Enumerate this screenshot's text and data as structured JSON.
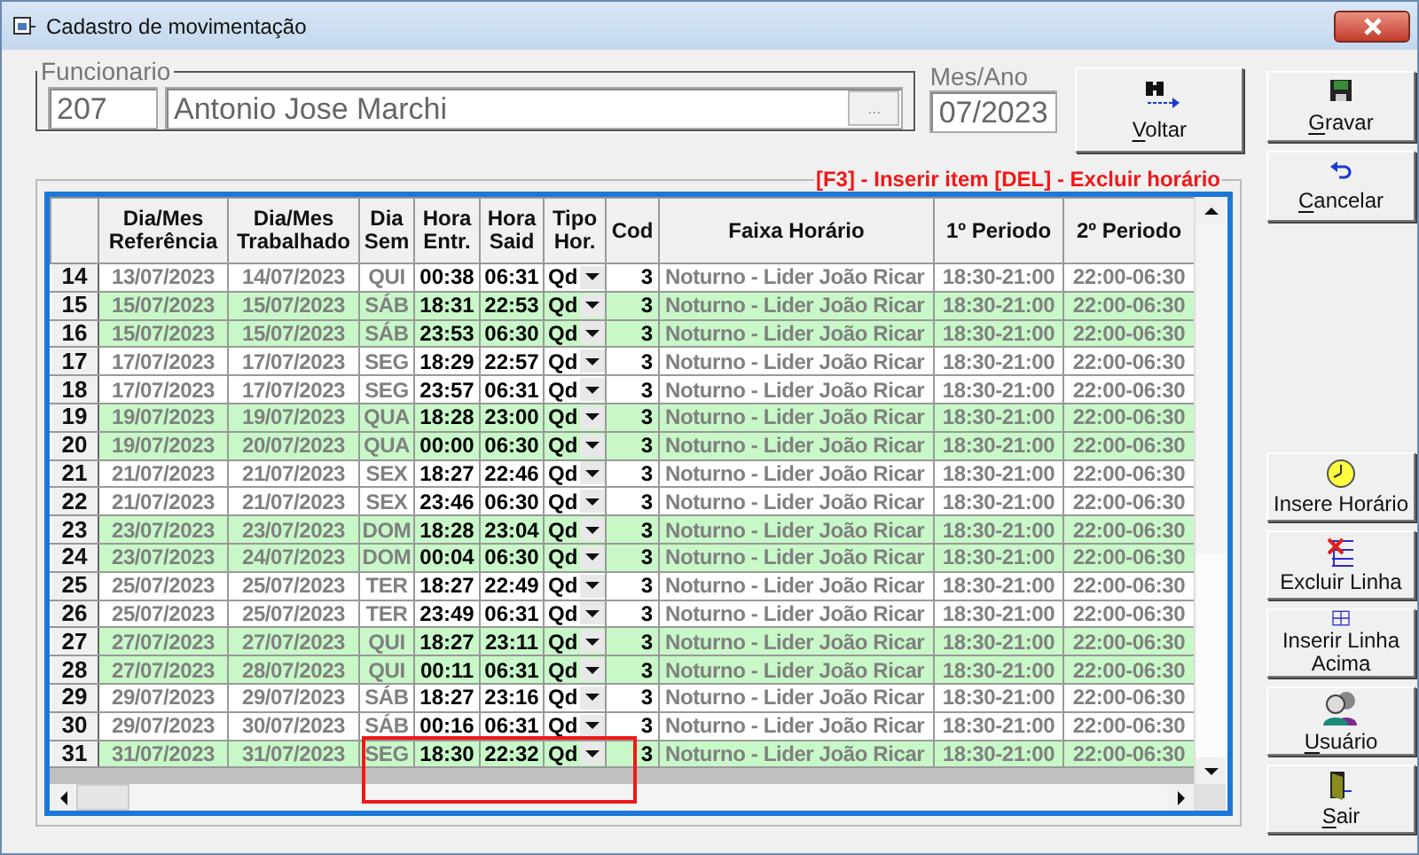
{
  "window": {
    "title": "Cadastro de movimentação"
  },
  "funcionario": {
    "label": "Funcionario",
    "code": "207",
    "name": "Antonio Jose Marchi",
    "lookup_button": "..."
  },
  "mes_ano": {
    "label": "Mes/Ano",
    "value": "07/2023"
  },
  "top_buttons": [
    {
      "kind": "voltar",
      "label": "Voltar"
    },
    {
      "kind": "gravar",
      "label": "Gravar"
    },
    {
      "kind": "cancelar",
      "label": "Cancelar"
    }
  ],
  "grid_hint": "[F3] - Inserir item [DEL] - Excluir horário",
  "columns": [
    "",
    "Dia/Mes Referência",
    "Dia/Mes Trabalhado",
    "Dia Sem",
    "Hora Entr.",
    "Hora Said",
    "Tipo Hor.",
    "Cod",
    "Faixa Horário",
    "1º Periodo",
    "2º Periodo"
  ],
  "rows": [
    {
      "num": "14",
      "ref": "13/07/2023",
      "trab": "14/07/2023",
      "dia": "QUI",
      "entrada": "00:38",
      "saida": "06:31",
      "tipo": "Qd",
      "cod": "3",
      "faixa": "Noturno - Lider João Ricar",
      "p1": "18:30-21:00",
      "p2": "22:00-06:30",
      "highlighted": false
    },
    {
      "num": "15",
      "ref": "15/07/2023",
      "trab": "15/07/2023",
      "dia": "SÁB",
      "entrada": "18:31",
      "saida": "22:53",
      "tipo": "Qd",
      "cod": "3",
      "faixa": "Noturno - Lider João Ricar",
      "p1": "18:30-21:00",
      "p2": "22:00-06:30",
      "highlighted": true
    },
    {
      "num": "16",
      "ref": "15/07/2023",
      "trab": "15/07/2023",
      "dia": "SÁB",
      "entrada": "23:53",
      "saida": "06:30",
      "tipo": "Qd",
      "cod": "3",
      "faixa": "Noturno - Lider João Ricar",
      "p1": "18:30-21:00",
      "p2": "22:00-06:30",
      "highlighted": true
    },
    {
      "num": "17",
      "ref": "17/07/2023",
      "trab": "17/07/2023",
      "dia": "SEG",
      "entrada": "18:29",
      "saida": "22:57",
      "tipo": "Qd",
      "cod": "3",
      "faixa": "Noturno - Lider João Ricar",
      "p1": "18:30-21:00",
      "p2": "22:00-06:30",
      "highlighted": false
    },
    {
      "num": "18",
      "ref": "17/07/2023",
      "trab": "17/07/2023",
      "dia": "SEG",
      "entrada": "23:57",
      "saida": "06:31",
      "tipo": "Qd",
      "cod": "3",
      "faixa": "Noturno - Lider João Ricar",
      "p1": "18:30-21:00",
      "p2": "22:00-06:30",
      "highlighted": false
    },
    {
      "num": "19",
      "ref": "19/07/2023",
      "trab": "19/07/2023",
      "dia": "QUA",
      "entrada": "18:28",
      "saida": "23:00",
      "tipo": "Qd",
      "cod": "3",
      "faixa": "Noturno - Lider João Ricar",
      "p1": "18:30-21:00",
      "p2": "22:00-06:30",
      "highlighted": true
    },
    {
      "num": "20",
      "ref": "19/07/2023",
      "trab": "20/07/2023",
      "dia": "QUA",
      "entrada": "00:00",
      "saida": "06:30",
      "tipo": "Qd",
      "cod": "3",
      "faixa": "Noturno - Lider João Ricar",
      "p1": "18:30-21:00",
      "p2": "22:00-06:30",
      "highlighted": true
    },
    {
      "num": "21",
      "ref": "21/07/2023",
      "trab": "21/07/2023",
      "dia": "SEX",
      "entrada": "18:27",
      "saida": "22:46",
      "tipo": "Qd",
      "cod": "3",
      "faixa": "Noturno - Lider João Ricar",
      "p1": "18:30-21:00",
      "p2": "22:00-06:30",
      "highlighted": false
    },
    {
      "num": "22",
      "ref": "21/07/2023",
      "trab": "21/07/2023",
      "dia": "SEX",
      "entrada": "23:46",
      "saida": "06:30",
      "tipo": "Qd",
      "cod": "3",
      "faixa": "Noturno - Lider João Ricar",
      "p1": "18:30-21:00",
      "p2": "22:00-06:30",
      "highlighted": false
    },
    {
      "num": "23",
      "ref": "23/07/2023",
      "trab": "23/07/2023",
      "dia": "DOM",
      "entrada": "18:28",
      "saida": "23:04",
      "tipo": "Qd",
      "cod": "3",
      "faixa": "Noturno - Lider João Ricar",
      "p1": "18:30-21:00",
      "p2": "22:00-06:30",
      "highlighted": true
    },
    {
      "num": "24",
      "ref": "23/07/2023",
      "trab": "24/07/2023",
      "dia": "DOM",
      "entrada": "00:04",
      "saida": "06:30",
      "tipo": "Qd",
      "cod": "3",
      "faixa": "Noturno - Lider João Ricar",
      "p1": "18:30-21:00",
      "p2": "22:00-06:30",
      "highlighted": true
    },
    {
      "num": "25",
      "ref": "25/07/2023",
      "trab": "25/07/2023",
      "dia": "TER",
      "entrada": "18:27",
      "saida": "22:49",
      "tipo": "Qd",
      "cod": "3",
      "faixa": "Noturno - Lider João Ricar",
      "p1": "18:30-21:00",
      "p2": "22:00-06:30",
      "highlighted": false
    },
    {
      "num": "26",
      "ref": "25/07/2023",
      "trab": "25/07/2023",
      "dia": "TER",
      "entrada": "23:49",
      "saida": "06:31",
      "tipo": "Qd",
      "cod": "3",
      "faixa": "Noturno - Lider João Ricar",
      "p1": "18:30-21:00",
      "p2": "22:00-06:30",
      "highlighted": false
    },
    {
      "num": "27",
      "ref": "27/07/2023",
      "trab": "27/07/2023",
      "dia": "QUI",
      "entrada": "18:27",
      "saida": "23:11",
      "tipo": "Qd",
      "cod": "3",
      "faixa": "Noturno - Lider João Ricar",
      "p1": "18:30-21:00",
      "p2": "22:00-06:30",
      "highlighted": true
    },
    {
      "num": "28",
      "ref": "27/07/2023",
      "trab": "28/07/2023",
      "dia": "QUI",
      "entrada": "00:11",
      "saida": "06:31",
      "tipo": "Qd",
      "cod": "3",
      "faixa": "Noturno - Lider João Ricar",
      "p1": "18:30-21:00",
      "p2": "22:00-06:30",
      "highlighted": true
    },
    {
      "num": "29",
      "ref": "29/07/2023",
      "trab": "29/07/2023",
      "dia": "SÁB",
      "entrada": "18:27",
      "saida": "23:16",
      "tipo": "Qd",
      "cod": "3",
      "faixa": "Noturno - Lider João Ricar",
      "p1": "18:30-21:00",
      "p2": "22:00-06:30",
      "highlighted": false
    },
    {
      "num": "30",
      "ref": "29/07/2023",
      "trab": "30/07/2023",
      "dia": "SÁB",
      "entrada": "00:16",
      "saida": "06:31",
      "tipo": "Qd",
      "cod": "3",
      "faixa": "Noturno - Lider João Ricar",
      "p1": "18:30-21:00",
      "p2": "22:00-06:30",
      "highlighted": false
    },
    {
      "num": "31",
      "ref": "31/07/2023",
      "trab": "31/07/2023",
      "dia": "SEG",
      "entrada": "18:30",
      "saida": "22:32",
      "tipo": "Qd",
      "cod": "3",
      "faixa": "Noturno - Lider João Ricar",
      "p1": "18:30-21:00",
      "p2": "22:00-06:30",
      "highlighted": true
    }
  ],
  "side_buttons": [
    {
      "kind": "insere_horario",
      "label": "Insere Horário"
    },
    {
      "kind": "excluir_linha",
      "label": "Excluir Linha"
    },
    {
      "kind": "inserir_linha",
      "label": "Inserir Linha Acima"
    },
    {
      "kind": "usuario",
      "label": "Usuário"
    },
    {
      "kind": "sair",
      "label": "Sair"
    }
  ]
}
